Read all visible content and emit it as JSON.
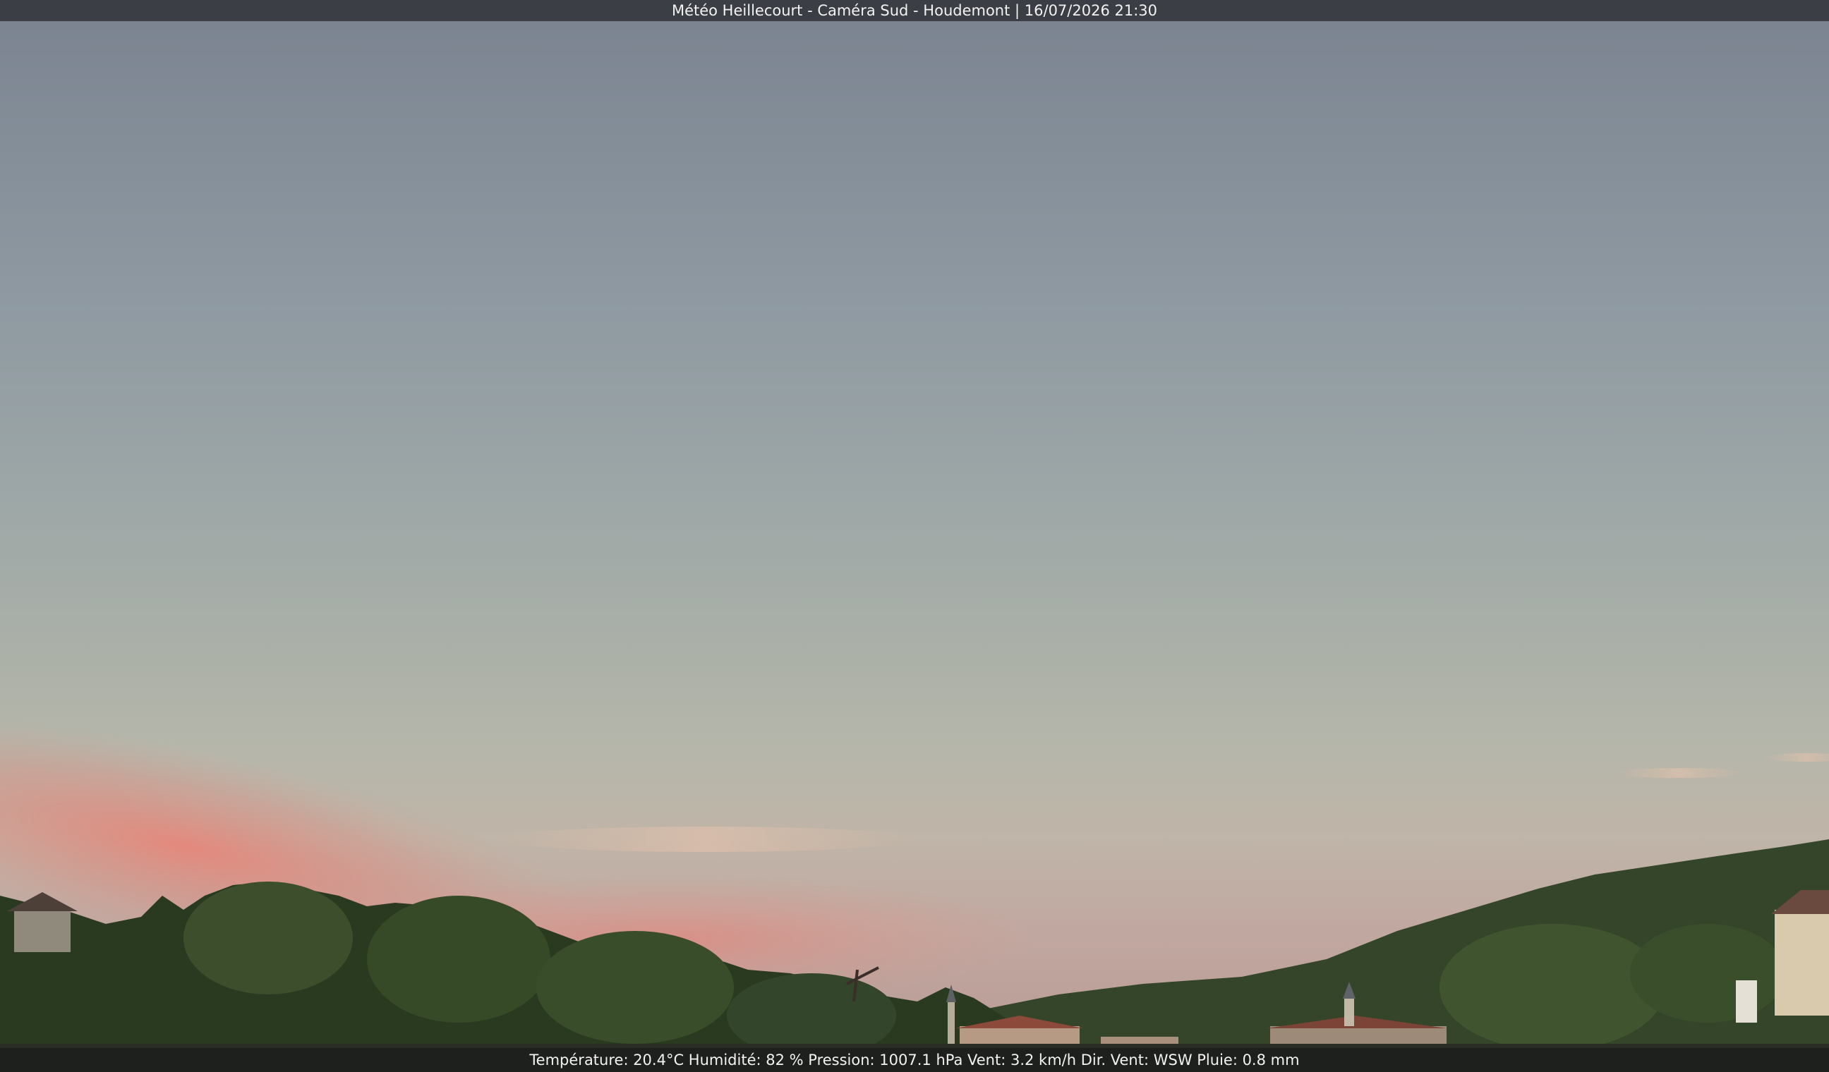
{
  "title_bar": {
    "text": "Météo Heillecourt - Caméra Sud - Houdemont | 16/07/2026 21:30"
  },
  "readout_bar": {
    "text": "Température: 20.4°C  Humidité: 82 % Pression: 1007.1 hPa Vent: 3.2 km/h Dir. Vent: WSW Pluie: 0.8 mm"
  },
  "scene": {
    "colors": {
      "sky_top": "#7a828f",
      "sky_horizon": "#c1a9a1",
      "sunset_pink": "#e0807a",
      "vegetation": "#2c3a22",
      "bars": "#3b3e44"
    }
  }
}
